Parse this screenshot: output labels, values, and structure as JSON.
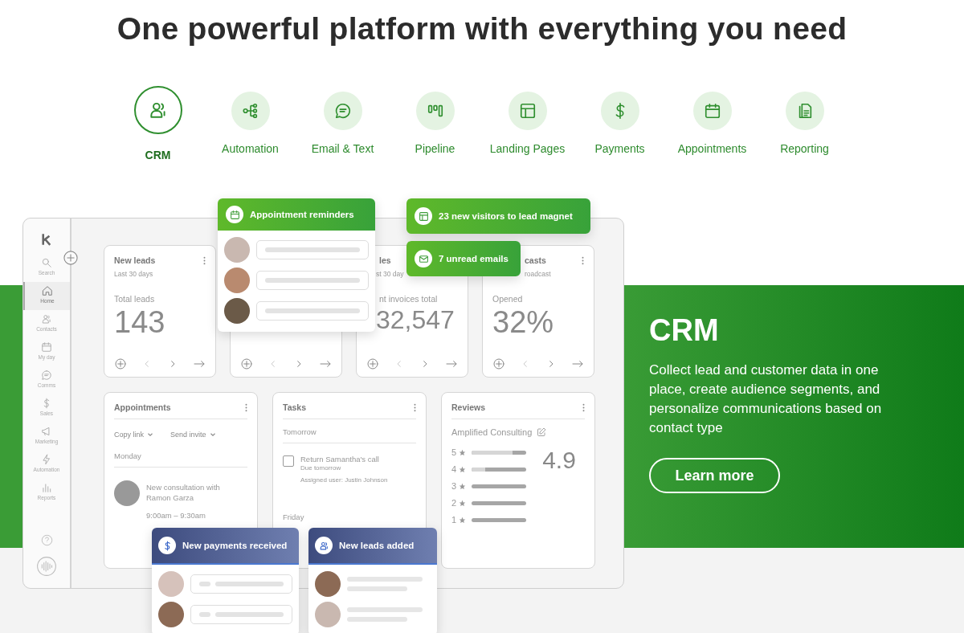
{
  "heading": "One powerful platform with everything you need",
  "tabs": [
    {
      "label": "CRM",
      "selected": true
    },
    {
      "label": "Automation",
      "selected": false
    },
    {
      "label": "Email & Text",
      "selected": false
    },
    {
      "label": "Pipeline",
      "selected": false
    },
    {
      "label": "Landing Pages",
      "selected": false
    },
    {
      "label": "Payments",
      "selected": false
    },
    {
      "label": "Appointments",
      "selected": false
    },
    {
      "label": "Reporting",
      "selected": false
    }
  ],
  "sidebar": {
    "items": [
      {
        "label": "Search",
        "selected": false
      },
      {
        "label": "Home",
        "selected": true
      },
      {
        "label": "Contacts",
        "selected": false
      },
      {
        "label": "My day",
        "selected": false
      },
      {
        "label": "Comms",
        "selected": false
      },
      {
        "label": "Sales",
        "selected": false
      },
      {
        "label": "Marketing",
        "selected": false
      },
      {
        "label": "Automation",
        "selected": false
      },
      {
        "label": "Reports",
        "selected": false
      }
    ]
  },
  "stat_cards": [
    {
      "kind": "stat",
      "title": "New leads",
      "subtitle": "Last 30 days",
      "metric_label": "Total leads",
      "value": "143"
    },
    {
      "kind": "covered"
    },
    {
      "kind": "stat",
      "title": "les",
      "subtitle": "st 30 day",
      "metric_label": "nt invoices total",
      "value": "32,547"
    },
    {
      "kind": "stat",
      "title": "casts",
      "subtitle": "roadcast",
      "metric_label": "Opened",
      "value": "32%"
    }
  ],
  "appointments": {
    "title": "Appointments",
    "actions": [
      "Copy link",
      "Send invite"
    ],
    "day": "Monday",
    "event": "New consultation with Ramon Garza",
    "time": "9:00am – 9:30am"
  },
  "tasks": {
    "title": "Tasks",
    "day": "Tomorrow",
    "task": {
      "title": "Return Samantha's call",
      "due": "Due tomorrow",
      "assignee": "Assigned user: Justin Johnson",
      "checked": false
    },
    "next_day": "Friday"
  },
  "reviews": {
    "title": "Reviews",
    "business": "Amplified Consulting",
    "rating": "4.9",
    "rows": [
      {
        "label": "5",
        "level": 0.75
      },
      {
        "label": "4",
        "level": 0.25
      },
      {
        "label": "3",
        "level": 0
      },
      {
        "label": "2",
        "level": 0
      },
      {
        "label": "1",
        "level": 0
      }
    ]
  },
  "notifications": [
    {
      "text": "Appointment reminders",
      "entries": [
        {
          "kind": "field"
        },
        {
          "kind": "field"
        },
        {
          "kind": "field"
        }
      ]
    },
    {
      "text": "23 new visitors to lead magnet"
    },
    {
      "text": "7 unread emails"
    },
    {
      "text": "New payments received",
      "entries": [
        {
          "kind": "field"
        },
        {
          "kind": "field"
        }
      ]
    },
    {
      "text": "New leads added",
      "entries": [
        {
          "kind": "lines"
        },
        {
          "kind": "lines"
        }
      ]
    }
  ],
  "feature": {
    "title": "CRM",
    "description": "Collect lead and customer data in one place, create audience segments, and personalize communications based on contact type",
    "button": "Learn more"
  }
}
